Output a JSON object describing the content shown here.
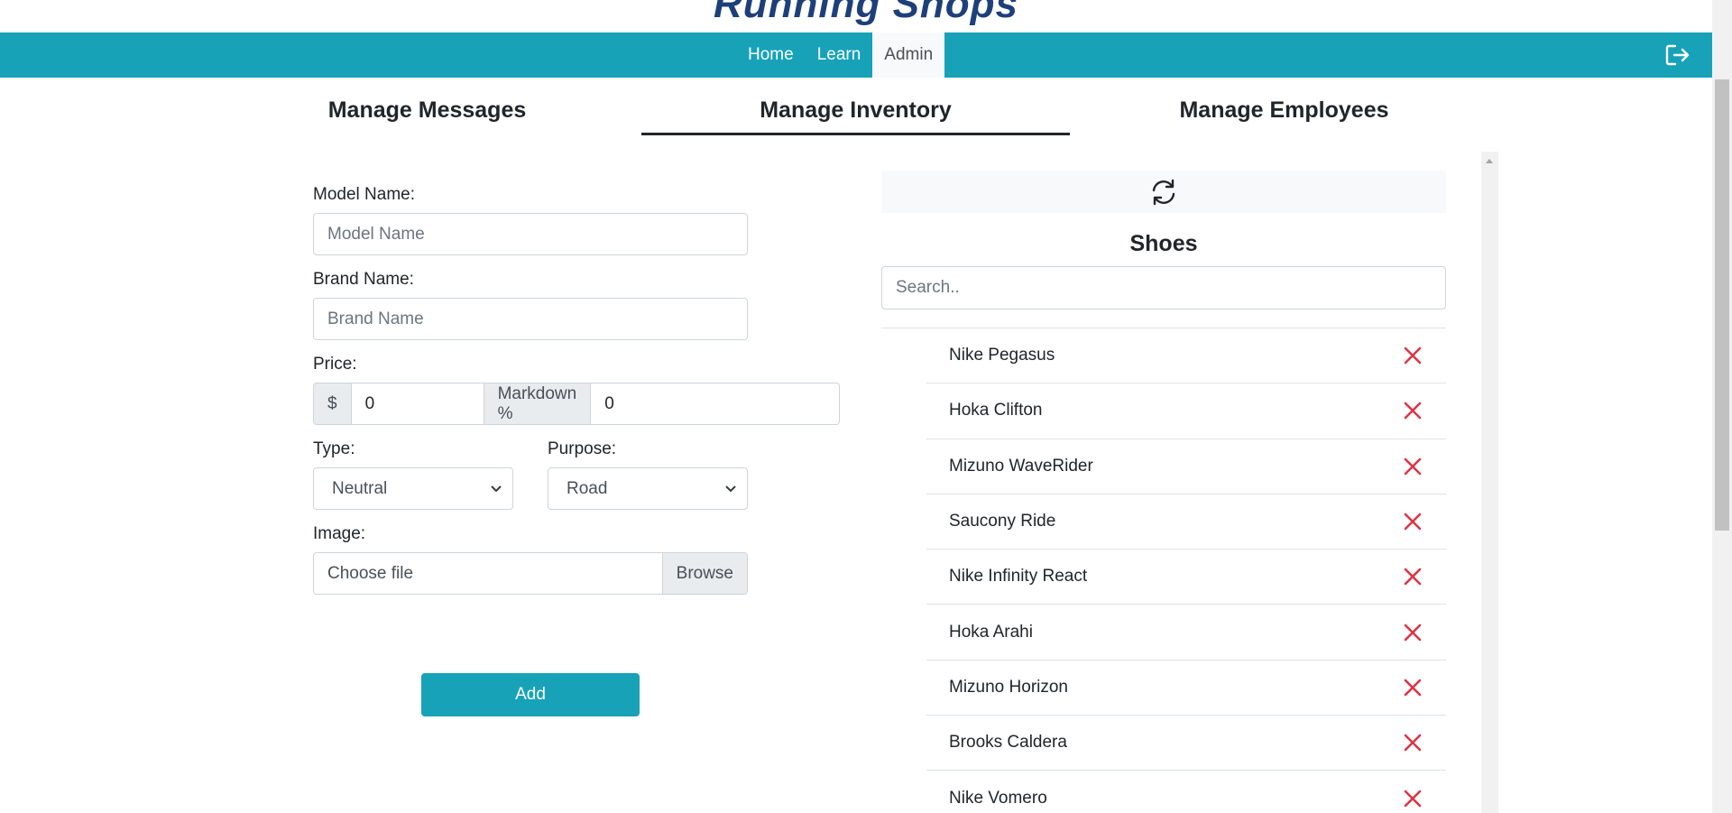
{
  "brand": {
    "logo_text": "Running Shops"
  },
  "nav": {
    "items": [
      {
        "label": "Home",
        "active": false
      },
      {
        "label": "Learn",
        "active": false
      },
      {
        "label": "Admin",
        "active": true
      }
    ],
    "logout_icon": "logout-icon"
  },
  "tabs": [
    {
      "label": "Manage Messages",
      "active": false
    },
    {
      "label": "Manage Inventory",
      "active": true
    },
    {
      "label": "Manage Employees",
      "active": false
    }
  ],
  "form": {
    "model_label": "Model Name:",
    "model_placeholder": "Model Name",
    "brand_label": "Brand Name:",
    "brand_placeholder": "Brand Name",
    "price_label": "Price:",
    "currency_symbol": "$",
    "price_value": "0",
    "markdown_label": "Markdown %",
    "markdown_value": "0",
    "type_label": "Type:",
    "type_selected": "Neutral",
    "purpose_label": "Purpose:",
    "purpose_selected": "Road",
    "image_label": "Image:",
    "file_placeholder": "Choose file",
    "browse_label": "Browse",
    "add_label": "Add"
  },
  "shoes_panel": {
    "refresh_icon": "refresh-icon",
    "title": "Shoes",
    "search_placeholder": "Search..",
    "items": [
      "Nike Pegasus",
      "Hoka Clifton",
      "Mizuno WaveRider",
      "Saucony Ride",
      "Nike Infinity React",
      "Hoka Arahi",
      "Mizuno Horizon",
      "Brooks Caldera",
      "Nike Vomero"
    ],
    "delete_icon": "close-icon",
    "delete_color": "#dc3545"
  },
  "colors": {
    "primary": "#17a2b8",
    "logo": "#1d3f7a"
  }
}
